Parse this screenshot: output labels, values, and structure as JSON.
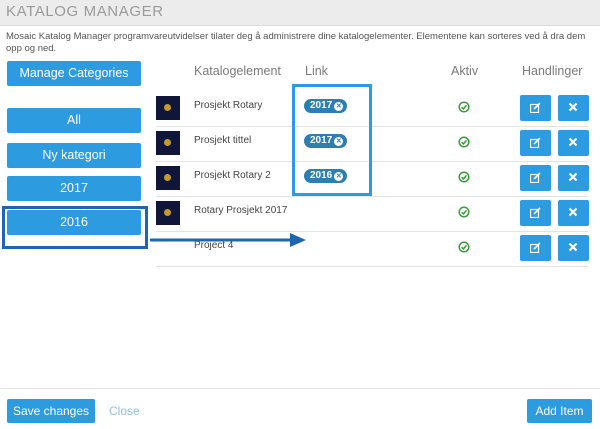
{
  "app_title": "KATALOG MANAGER",
  "description": "Mosaic Katalog Manager programvareutvidelser tilater deg å administrere dine katalogelementer. Elementene kan sorteres ved å dra dem opp og ned.",
  "sidebar": {
    "manage_label": "Manage Categories",
    "categories": [
      "All",
      "Ny kategori",
      "2017",
      "2016"
    ]
  },
  "table": {
    "headers": {
      "element": "Katalogelement",
      "link": "Link",
      "active": "Aktiv",
      "actions": "Handlinger"
    },
    "rows": [
      {
        "name": "Prosjekt Rotary",
        "badge": "2017",
        "active": true
      },
      {
        "name": "Prosjekt tittel",
        "badge": "2017",
        "active": true
      },
      {
        "name": "Prosjekt Rotary 2",
        "badge": "2016",
        "active": true
      },
      {
        "name": "Rotary Prosjekt 2017",
        "badge": "",
        "active": true
      },
      {
        "name": "Project 4",
        "badge": "",
        "active": true
      }
    ]
  },
  "footer": {
    "save_label": "Save changes",
    "close_label": "Close",
    "add_label": "Add Item"
  },
  "icons": {
    "check": "check-circle-icon",
    "edit": "edit-icon",
    "delete": "delete-icon",
    "badge_remove": "remove-circle-icon",
    "arrow": "arrow-right-icon"
  },
  "colors": {
    "accent": "#2d9be0",
    "badge": "#2e7fb0",
    "check": "#3a9a3a",
    "highlight_dark": "#1d67b0"
  }
}
